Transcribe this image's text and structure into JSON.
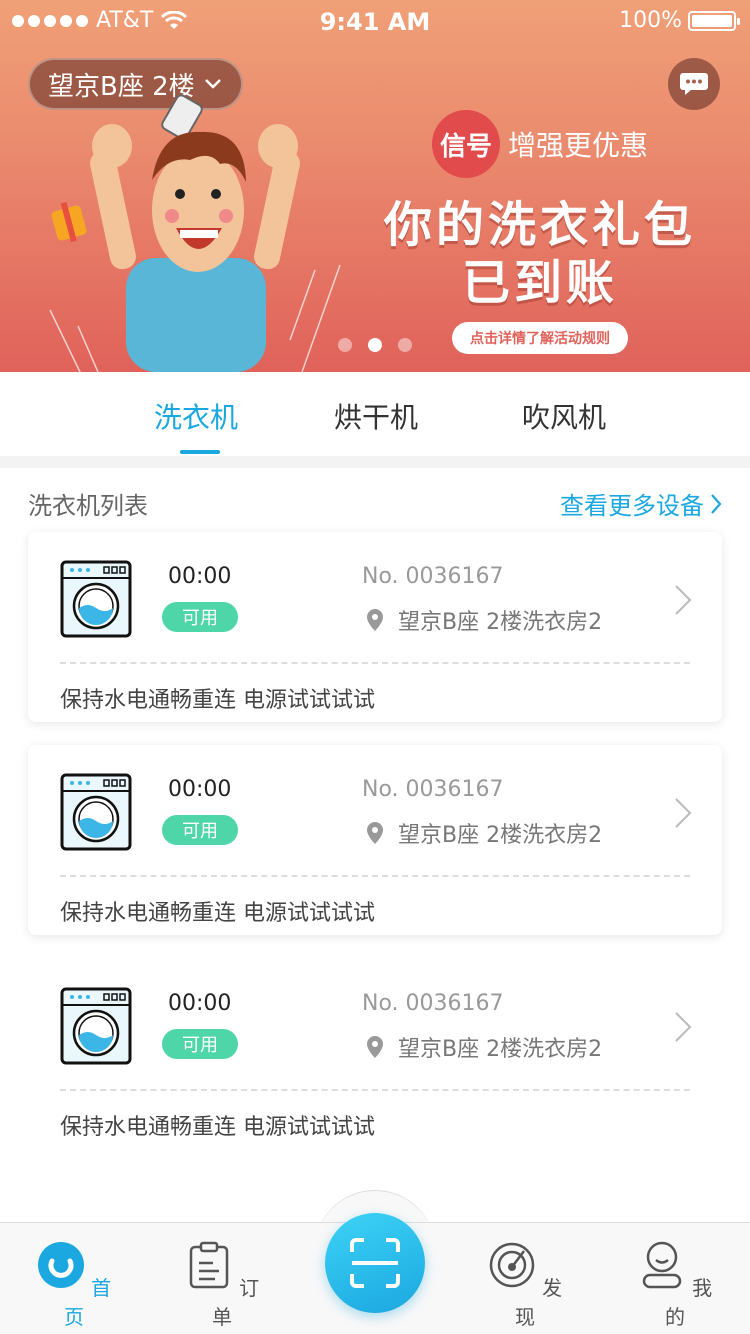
{
  "status_bar": {
    "carrier": "AT&T",
    "time": "9:41 AM",
    "battery": "100%"
  },
  "banner": {
    "location_selector": "望京B座 2楼",
    "promo_badge": "信号",
    "promo_tagline": "增强更优惠",
    "promo_title_line1": "你的洗衣礼包",
    "promo_title_line2": "已到账",
    "promo_cta": "点击详情了解活动规则",
    "pager_count": 3,
    "pager_active": 2
  },
  "tabs": [
    {
      "label": "洗衣机",
      "active": true
    },
    {
      "label": "烘干机",
      "active": false
    },
    {
      "label": "吹风机",
      "active": false
    }
  ],
  "list": {
    "title": "洗衣机列表",
    "more_link": "查看更多设备",
    "devices": [
      {
        "timer": "00:00",
        "status": "可用",
        "number": "No. 0036167",
        "location": "望京B座 2楼洗衣房2",
        "note": "保持水电通畅重连 电源试试试试"
      },
      {
        "timer": "00:00",
        "status": "可用",
        "number": "No. 0036167",
        "location": "望京B座 2楼洗衣房2",
        "note": "保持水电通畅重连 电源试试试试"
      },
      {
        "timer": "00:00",
        "status": "可用",
        "number": "No. 0036167",
        "location": "望京B座 2楼洗衣房2",
        "note": "保持水电通畅重连 电源试试试试"
      }
    ]
  },
  "bottom_nav": {
    "items": [
      {
        "label": "首页",
        "icon": "home-icon",
        "active": true
      },
      {
        "label": "订单",
        "icon": "order-icon",
        "active": false
      },
      {
        "label": "发现",
        "icon": "discover-icon",
        "active": false
      },
      {
        "label": "我的",
        "icon": "profile-icon",
        "active": false
      }
    ],
    "center_icon": "scan-icon"
  },
  "colors": {
    "accent": "#1ba7e0",
    "available": "#4fd6a8",
    "banner_top": "#f0a077",
    "banner_bottom": "#e0625a"
  }
}
